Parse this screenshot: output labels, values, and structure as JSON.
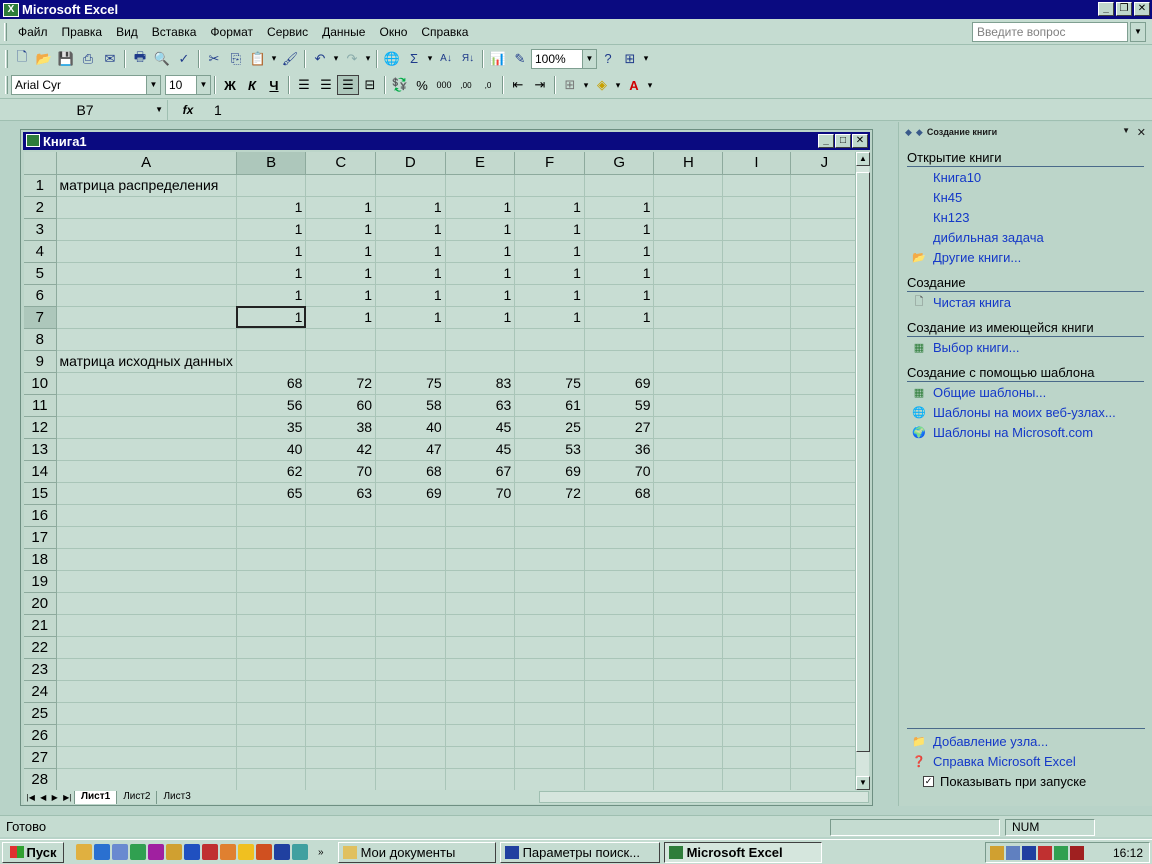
{
  "app": {
    "title": "Microsoft Excel",
    "ask_placeholder": "Введите вопрос"
  },
  "menu": [
    "Файл",
    "Правка",
    "Вид",
    "Вставка",
    "Формат",
    "Сервис",
    "Данные",
    "Окно",
    "Справка"
  ],
  "toolbar": {
    "zoom": "100%",
    "font": "Arial Cyr",
    "font_size": "10",
    "bold": "Ж",
    "italic": "К",
    "underline": "Ч"
  },
  "formula": {
    "cell_ref": "B7",
    "fx": "fx",
    "value": "1"
  },
  "workbook": {
    "title": "Книга1",
    "columns": [
      "A",
      "B",
      "C",
      "D",
      "E",
      "F",
      "G",
      "H",
      "I",
      "J"
    ],
    "rows": [
      [
        "матрица распределения",
        "",
        "",
        "",
        "",
        "",
        "",
        "",
        "",
        ""
      ],
      [
        "",
        "1",
        "1",
        "1",
        "1",
        "1",
        "1",
        "",
        "",
        ""
      ],
      [
        "",
        "1",
        "1",
        "1",
        "1",
        "1",
        "1",
        "",
        "",
        ""
      ],
      [
        "",
        "1",
        "1",
        "1",
        "1",
        "1",
        "1",
        "",
        "",
        ""
      ],
      [
        "",
        "1",
        "1",
        "1",
        "1",
        "1",
        "1",
        "",
        "",
        ""
      ],
      [
        "",
        "1",
        "1",
        "1",
        "1",
        "1",
        "1",
        "",
        "",
        ""
      ],
      [
        "",
        "1",
        "1",
        "1",
        "1",
        "1",
        "1",
        "",
        "",
        ""
      ],
      [
        "",
        "",
        "",
        "",
        "",
        "",
        "",
        "",
        "",
        ""
      ],
      [
        "матрица исходных данных",
        "",
        "",
        "",
        "",
        "",
        "",
        "",
        "",
        ""
      ],
      [
        "",
        "68",
        "72",
        "75",
        "83",
        "75",
        "69",
        "",
        "",
        ""
      ],
      [
        "",
        "56",
        "60",
        "58",
        "63",
        "61",
        "59",
        "",
        "",
        ""
      ],
      [
        "",
        "35",
        "38",
        "40",
        "45",
        "25",
        "27",
        "",
        "",
        ""
      ],
      [
        "",
        "40",
        "42",
        "47",
        "45",
        "53",
        "36",
        "",
        "",
        ""
      ],
      [
        "",
        "62",
        "70",
        "68",
        "67",
        "69",
        "70",
        "",
        "",
        ""
      ],
      [
        "",
        "65",
        "63",
        "69",
        "70",
        "72",
        "68",
        "",
        "",
        ""
      ]
    ],
    "total_rows": 28,
    "active_cell": "B7",
    "sheets": [
      "Лист1",
      "Лист2",
      "Лист3"
    ]
  },
  "taskpane": {
    "title": "Создание книги",
    "sections": [
      {
        "heading": "Открытие книги",
        "links": [
          {
            "label": "Книга10",
            "icon": ""
          },
          {
            "label": "Кн45",
            "icon": ""
          },
          {
            "label": "Кн123",
            "icon": ""
          },
          {
            "label": "дибильная задача",
            "icon": ""
          },
          {
            "label": "Другие книги...",
            "icon": "folder-icon"
          }
        ]
      },
      {
        "heading": "Создание",
        "links": [
          {
            "label": "Чистая книга",
            "icon": "blank-doc-icon"
          }
        ]
      },
      {
        "heading": "Создание из имеющейся книги",
        "links": [
          {
            "label": "Выбор книги...",
            "icon": "workbook-icon"
          }
        ]
      },
      {
        "heading": "Создание с помощью шаблона",
        "links": [
          {
            "label": "Общие шаблоны...",
            "icon": "template-icon"
          },
          {
            "label": "Шаблоны на моих веб-узлах...",
            "icon": "web-template-icon"
          },
          {
            "label": "Шаблоны на Microsoft.com",
            "icon": "globe-icon"
          }
        ]
      }
    ],
    "footer_links": [
      {
        "label": "Добавление узла...",
        "icon": "add-site-icon"
      },
      {
        "label": "Справка Microsoft Excel",
        "icon": "help-icon"
      }
    ],
    "show_at_startup": "Показывать при запуске"
  },
  "status": {
    "ready": "Готово",
    "num": "NUM"
  },
  "taskbar": {
    "start": "Пуск",
    "tasks": [
      "Мои документы",
      "Параметры поиск...",
      "Microsoft Excel"
    ],
    "clock": "16:12"
  }
}
